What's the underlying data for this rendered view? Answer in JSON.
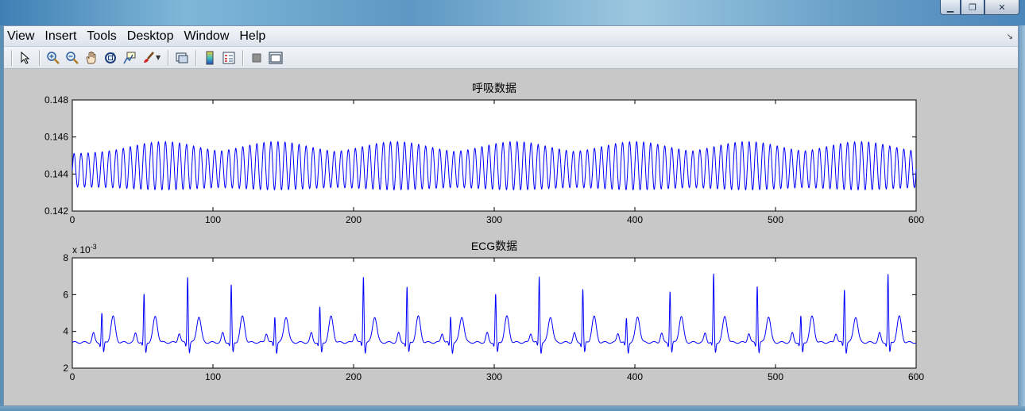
{
  "window": {
    "controls": [
      {
        "name": "minimize-button",
        "glyph": "▁"
      },
      {
        "name": "maximize-button",
        "glyph": "❐"
      },
      {
        "name": "close-button",
        "glyph": "✕"
      }
    ]
  },
  "menubar": {
    "items": [
      "View",
      "Insert",
      "Tools",
      "Desktop",
      "Window",
      "Help"
    ],
    "dock_glyph": "↘"
  },
  "toolbar": {
    "icons": [
      "pointer-icon",
      "zoom-in-icon",
      "zoom-out-icon",
      "pan-hand-icon",
      "rotate-3d-icon",
      "data-cursor-icon",
      "brush-icon",
      "link-plot-icon",
      "colorbar-icon",
      "legend-icon",
      "hide-plot-tools-icon",
      "show-plot-tools-icon"
    ]
  },
  "chart_data": [
    {
      "type": "line",
      "title": "呼吸数据",
      "xlim": [
        0,
        600
      ],
      "ylim": [
        0.142,
        0.148
      ],
      "xticks": [
        "0",
        "100",
        "200",
        "300",
        "400",
        "500",
        "600"
      ],
      "yticks": [
        "0.142",
        "0.144",
        "0.146",
        "0.148"
      ],
      "color": "#0000ff",
      "series": [
        {
          "x": [
            0,
            600
          ],
          "baseline": 0.1442,
          "oscillation_cycles": 120,
          "amplitude_min": 0.0009,
          "amplitude_max": 0.0013,
          "envelope_peaks_x": [
            65,
            145,
            230,
            315,
            400,
            480,
            560
          ]
        }
      ]
    },
    {
      "type": "line",
      "title": "ECG数据",
      "exponent_label": "x 10",
      "exponent_power": "-3",
      "xlim": [
        0,
        600
      ],
      "ylim": [
        2,
        8
      ],
      "xticks": [
        "0",
        "100",
        "200",
        "300",
        "400",
        "500",
        "600"
      ],
      "yticks": [
        "2",
        "4",
        "6",
        "8"
      ],
      "color": "#0000ff",
      "series": [
        {
          "baseline": 3.4,
          "r_peaks": [
            {
              "x": 21,
              "y": 5.0
            },
            {
              "x": 51,
              "y": 6.0
            },
            {
              "x": 82,
              "y": 7.0
            },
            {
              "x": 113,
              "y": 6.5
            },
            {
              "x": 144,
              "y": 4.8
            },
            {
              "x": 176,
              "y": 5.3
            },
            {
              "x": 207,
              "y": 7.0
            },
            {
              "x": 238,
              "y": 6.4
            },
            {
              "x": 269,
              "y": 4.8
            },
            {
              "x": 301,
              "y": 6.0
            },
            {
              "x": 332,
              "y": 7.0
            },
            {
              "x": 363,
              "y": 6.3
            },
            {
              "x": 394,
              "y": 4.7
            },
            {
              "x": 425,
              "y": 6.2
            },
            {
              "x": 456,
              "y": 7.1
            },
            {
              "x": 487,
              "y": 6.5
            },
            {
              "x": 518,
              "y": 4.8
            },
            {
              "x": 549,
              "y": 6.3
            },
            {
              "x": 580,
              "y": 7.1
            }
          ],
          "t_wave_height": 4.8
        }
      ]
    }
  ]
}
